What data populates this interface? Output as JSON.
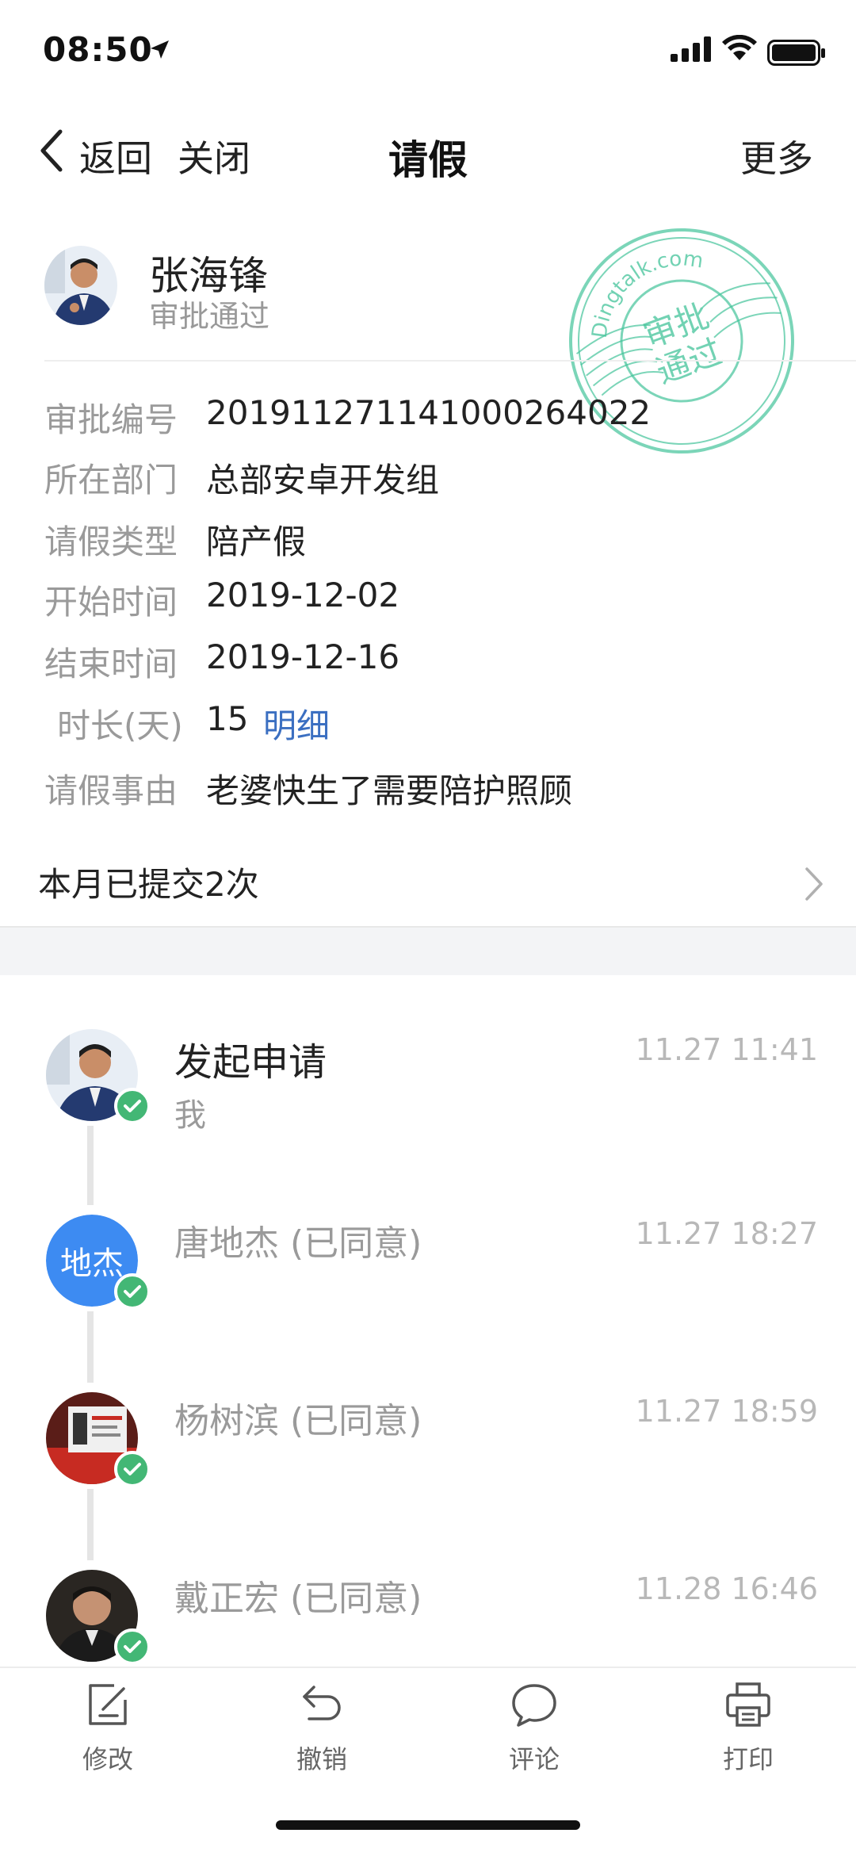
{
  "status_bar": {
    "time": "08:50"
  },
  "nav": {
    "back_label": "返回",
    "close_label": "关闭",
    "title": "请假",
    "more_label": "更多"
  },
  "header": {
    "name": "张海锋",
    "status": "审批通过"
  },
  "stamp": {
    "outer_text": "Dingtalk.com",
    "line1": "审批",
    "line2": "通过",
    "color": "#43c39a"
  },
  "details": {
    "approval_no_label": "审批编号",
    "approval_no": "20191127114100026402​2",
    "department_label": "所在部门",
    "department": "总部安卓开发组",
    "leave_type_label": "请假类型",
    "leave_type": "陪产假",
    "start_label": "开始时间",
    "start": "2019-12-02",
    "end_label": "结束时间",
    "end": "2019-12-16",
    "duration_label": "时长(天)",
    "duration": "15",
    "duration_link": "明细",
    "reason_label": "请假事由",
    "reason": "老婆快生了需要陪护照顾"
  },
  "monthly": {
    "text": "本月已提交2次"
  },
  "timeline": [
    {
      "title": "发起申请",
      "sub": "我",
      "time": "11.27 11:41"
    },
    {
      "initials": "地杰",
      "title": "唐地杰 (已同意)",
      "time": "11.27 18:27"
    },
    {
      "title": "杨树滨 (已同意)",
      "time": "11.27 18:59"
    },
    {
      "title": "戴正宏 (已同意)",
      "time": "11.28 16:46"
    }
  ],
  "toolbar": {
    "edit": "修改",
    "revoke": "撤销",
    "comment": "评论",
    "print": "打印"
  },
  "colors": {
    "accent": "#3b6fc1",
    "approved": "#43b775",
    "avatar_blue": "#3d8bf2"
  }
}
